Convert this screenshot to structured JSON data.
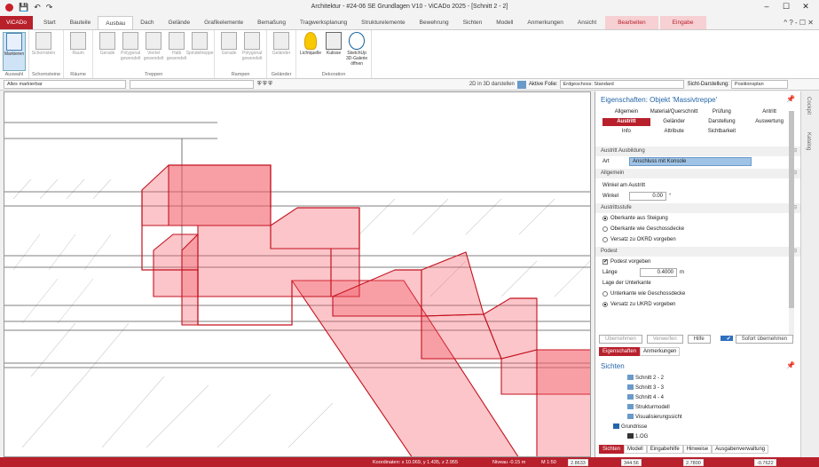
{
  "window": {
    "title": "Architektur - #24-06 SE Grundlagen V10 - ViCADo 2025 - [Schnitt 2 - 2]"
  },
  "tabs": [
    {
      "label": "ViCADo",
      "kind": "app"
    },
    {
      "label": "Start",
      "kind": ""
    },
    {
      "label": "Bauteile",
      "kind": ""
    },
    {
      "label": "Ausbau",
      "kind": "active"
    },
    {
      "label": "Dach",
      "kind": ""
    },
    {
      "label": "Gelände",
      "kind": ""
    },
    {
      "label": "Grafikelemente",
      "kind": ""
    },
    {
      "label": "Bemaßung",
      "kind": ""
    },
    {
      "label": "Tragwerksplanung",
      "kind": ""
    },
    {
      "label": "Strukturelemente",
      "kind": ""
    },
    {
      "label": "Bewehrung",
      "kind": ""
    },
    {
      "label": "Sichten",
      "kind": ""
    },
    {
      "label": "Modell",
      "kind": ""
    },
    {
      "label": "Anmerkungen",
      "kind": ""
    },
    {
      "label": "Ansicht",
      "kind": ""
    },
    {
      "label": "Bearbeiten",
      "kind": "ctx"
    },
    {
      "label": "Eingabe",
      "kind": "ctx"
    }
  ],
  "ribbon": {
    "groups": [
      {
        "label": "Auswahl",
        "buttons": [
          {
            "label": "Markieren",
            "style": "sel"
          }
        ]
      },
      {
        "label": "Schornsteine",
        "buttons": [
          {
            "label": "Schornstein",
            "style": ""
          }
        ]
      },
      {
        "label": "Räume",
        "buttons": [
          {
            "label": "Raum",
            "style": ""
          }
        ]
      },
      {
        "label": "Treppen",
        "buttons": [
          {
            "label": "Gerade",
            "style": ""
          },
          {
            "label": "Polygonal gewendelt",
            "style": ""
          },
          {
            "label": "Viertel gewendelt",
            "style": ""
          },
          {
            "label": "Halb gewendelt",
            "style": ""
          },
          {
            "label": "Spindeltreppe",
            "style": ""
          }
        ]
      },
      {
        "label": "Rampen",
        "buttons": [
          {
            "label": "Gerade",
            "style": ""
          },
          {
            "label": "Polygonal gewendelt",
            "style": ""
          }
        ]
      },
      {
        "label": "Geländer",
        "buttons": [
          {
            "label": "Geländer",
            "style": ""
          }
        ]
      },
      {
        "label": "Dekoration",
        "buttons": [
          {
            "label": "Lichtquelle",
            "style": "dark bulb"
          },
          {
            "label": "Kulisse",
            "style": "dark"
          },
          {
            "label": "SketchUp 3D-Galerie öffnen",
            "style": "dark skp"
          }
        ]
      }
    ]
  },
  "toolbar": {
    "filter": "Alles markierbar",
    "view3d": "2D in 3D darstellen",
    "active_folie_label": "Aktive Folie:",
    "active_folie": "Erdgeschoss: Standard",
    "sicht_label": "Sicht-Darstellung:",
    "sicht": "Positionsplan"
  },
  "properties": {
    "title": "Eigenschaften: Objekt 'Massivtreppe'",
    "tabs": [
      "Allgemein",
      "Material/Querschnitt",
      "Prüfung",
      "Antritt",
      "Austritt",
      "Geländer",
      "Darstellung",
      "Auswertung",
      "Info",
      "Attribute",
      "Sichtbarkeit"
    ],
    "active_tab": "Austritt",
    "austritt_ausbildung": "Austritt Ausbildung",
    "art_label": "Art",
    "art_value": "Anschluss mit Konsole",
    "allgemein": "Allgemein",
    "winkel_header": "Winkel am Austritt",
    "winkel_label": "Winkel",
    "winkel_value": "0.00",
    "winkel_unit": "°",
    "austrittsstufe": "Austrittsstufe",
    "opt1": "Oberkante aus Steigung",
    "opt2": "Oberkante wie Geschossdecke",
    "opt3": "Versatz zu OKRD vorgeben",
    "podest": "Podest",
    "podest_chk": "Podest vorgeben",
    "laenge_label": "Länge",
    "laenge_value": "0.4000",
    "laenge_unit": "m",
    "lage_header": "Lage der Unterkante",
    "lage_opt1": "Unterkante wie Geschossdecke",
    "lage_opt2": "Versatz zu UKRD vorgeben",
    "btn_apply": "Übernehmen",
    "btn_discard": "Verwerfen",
    "btn_help": "Hilfe",
    "sofort": "Sofort übernehmen",
    "subtabs": [
      "Eigenschaften",
      "Anmerkungen"
    ]
  },
  "views": {
    "title": "Sichten",
    "items": [
      "Schnitt 2 - 2",
      "Schnitt 3 - 3",
      "Schnitt 4 - 4",
      "Strukturmodell",
      "Visualisierungssicht",
      "Grundrisse",
      "1.OG"
    ],
    "bottom_tabs": [
      "Sichten",
      "Modell",
      "Eingabehilfe",
      "Hinweise",
      "Ausgabenverwaltung"
    ]
  },
  "side_tabs": [
    "Cockpit",
    "Katalog"
  ],
  "status": {
    "coords": "Koordinaten: x 10.069, y 1.435, z 2.955",
    "niveau": "Niveau -0.15 m",
    "scale": "M 1:50",
    "dx": "2.8633",
    "w": "344.56",
    "x": "2.7800",
    "dy": "-0.7622"
  }
}
